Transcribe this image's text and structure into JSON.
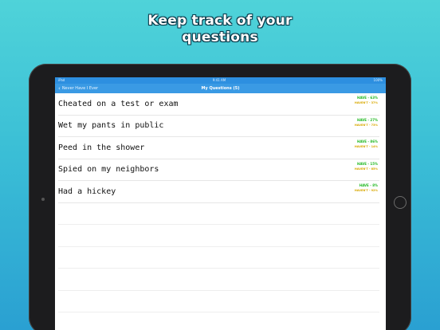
{
  "headline": {
    "line1": "Keep track of your",
    "line2": "questions"
  },
  "status_bar": {
    "left": "iPad",
    "center": "9:41 AM",
    "right": "100%"
  },
  "nav": {
    "back_label": "Never Have I Ever",
    "title": "My Questions (5)"
  },
  "questions": [
    {
      "text": "Cheated on a test or exam",
      "have": "HAVE - 63%",
      "havent": "HAVEN'T - 37%"
    },
    {
      "text": "Wet my pants in public",
      "have": "HAVE - 27%",
      "havent": "HAVEN'T - 73%"
    },
    {
      "text": "Peed in the shower",
      "have": "HAVE - 86%",
      "havent": "HAVEN'T - 14%"
    },
    {
      "text": "Spied on my neighbors",
      "have": "HAVE - 15%",
      "havent": "HAVEN'T - 85%"
    },
    {
      "text": "Had a hickey",
      "have": "HAVE - 8%",
      "havent": "HAVEN'T - 92%"
    }
  ],
  "colors": {
    "nav_blue": "#3a9ae4",
    "have_green": "#20b820",
    "havent_yellow": "#d8a800"
  }
}
